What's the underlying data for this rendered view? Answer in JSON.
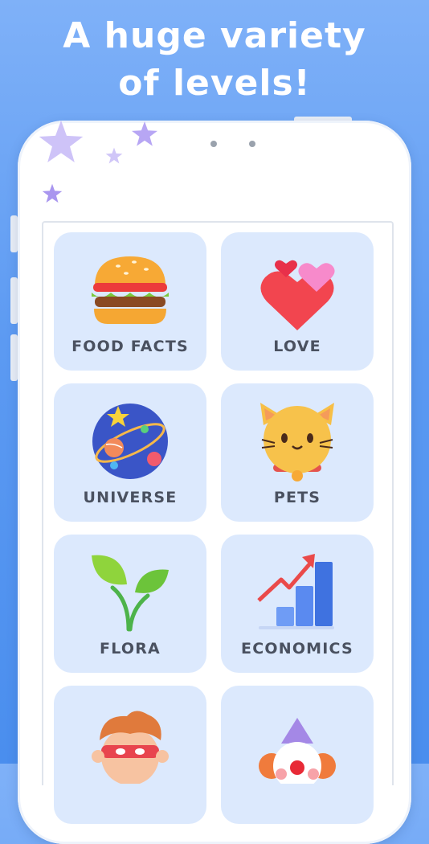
{
  "headline": {
    "line1": "A huge variety",
    "line2": "of levels!"
  },
  "levels": [
    {
      "label": "FOOD FACTS",
      "icon": "burger-icon"
    },
    {
      "label": "LOVE",
      "icon": "hearts-icon"
    },
    {
      "label": "UNIVERSE",
      "icon": "planet-icon"
    },
    {
      "label": "PETS",
      "icon": "cat-icon"
    },
    {
      "label": "FLORA",
      "icon": "sprout-icon"
    },
    {
      "label": "ECONOMICS",
      "icon": "growth-chart-icon"
    },
    {
      "label": "",
      "icon": "superhero-icon"
    },
    {
      "label": "",
      "icon": "clown-icon"
    }
  ],
  "colors": {
    "background_top": "#7fb1f8",
    "background_bottom": "#4a8eee",
    "card": "#dce9fd",
    "label": "#4a5160",
    "star": "#b7a6f4"
  }
}
